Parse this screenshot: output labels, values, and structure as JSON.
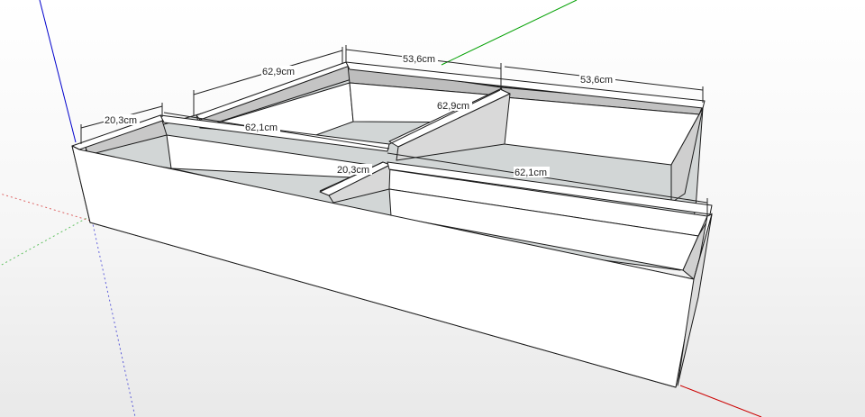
{
  "colors": {
    "background_top": "#ffffff",
    "background_bottom": "#e8e8e8",
    "face_light": "#ffffff",
    "face_shade": "#d6d6d6",
    "floor": "#d2d6d6",
    "edge": "#1a1a1a",
    "axis_red": "#cc0000",
    "axis_green": "#00a000",
    "axis_blue": "#0000cc"
  },
  "dimensions": {
    "d1": "53,6cm",
    "d2": "53,6cm",
    "d3": "62,9cm",
    "d4": "62,9cm",
    "d5": "20,3cm",
    "d6": "62,1cm",
    "d7": "20,3cm",
    "d8": "62,1cm"
  }
}
